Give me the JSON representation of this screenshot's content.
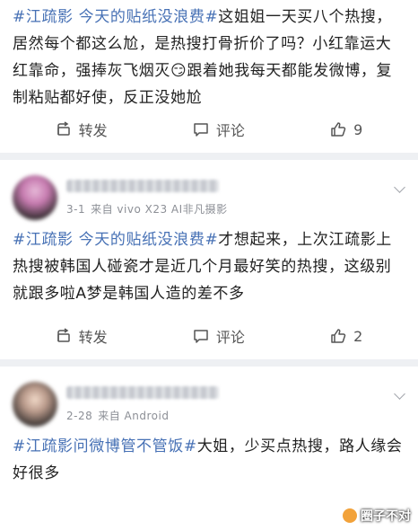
{
  "posts": [
    {
      "segments": [
        {
          "text": "#江疏影 今天的贴纸没浪费#",
          "topic": true
        },
        {
          "text": "这姐姐一天买八个热搜，居然每个都这么尬，是热搜打骨折价了吗？小红靠运大红靠命，强捧灰飞烟灭",
          "topic": false
        },
        {
          "text": "😏",
          "topic": false
        },
        {
          "text": "跟着她我每天都能发微博，复制粘贴都好使，反正没她尬",
          "topic": false
        }
      ],
      "actions": {
        "repost": "转发",
        "comment": "评论",
        "likes": "9"
      }
    },
    {
      "date": "3-1",
      "source": "来自 vivo X23 AI非凡摄影",
      "segments": [
        {
          "text": "#江疏影 今天的贴纸没浪费#",
          "topic": true
        },
        {
          "text": "才想起来，上次江疏影上热搜被韩国人碰瓷才是近几个月最好笑的热搜，这级别就跟多啦A梦是韩国人造的差不多",
          "topic": false
        }
      ],
      "actions": {
        "repost": "转发",
        "comment": "评论",
        "likes": "2"
      }
    },
    {
      "date": "2-28",
      "source": "来自 Android",
      "segments": [
        {
          "text": "#江疏影问微博管不管饭#",
          "topic": true
        },
        {
          "text": "大姐，少买点热搜，路人缘会好很多",
          "topic": false
        }
      ]
    }
  ],
  "watermark": "圈子不对",
  "colors": {
    "topic": "#4771b5",
    "background": "#eef0f3",
    "card": "#ffffff",
    "meta": "#8c8f96"
  },
  "icons": {
    "repost": "repost-icon",
    "comment": "comment-icon",
    "like": "thumbs-up-icon",
    "menu": "chevron-down-icon"
  }
}
